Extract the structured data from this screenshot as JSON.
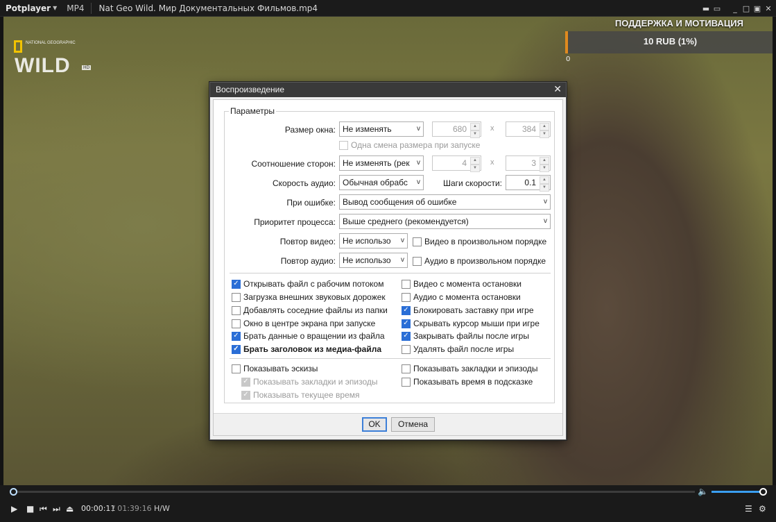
{
  "app": {
    "name": "Potplayer",
    "format": "MP4",
    "file_title": "Nat Geo Wild. Мир Документальных Фильмов.mp4"
  },
  "overlay": {
    "logo_small": "NATIONAL GEOGRAPHIC",
    "logo_big": "WILD",
    "logo_badge": "HD",
    "donate_title": "ПОДДЕРЖКА И МОТИВАЦИЯ",
    "donate_amount": "10 RUB (1%)",
    "donate_min": "0"
  },
  "dialog": {
    "title": "Воспроизведение",
    "group_label": "Параметры",
    "window_size": {
      "label": "Размер окна:",
      "value": "Не изменять",
      "width": "680",
      "height": "384"
    },
    "resize_once": {
      "label": "Одна смена размера при запуске",
      "checked": false,
      "disabled": true
    },
    "aspect": {
      "label": "Соотношение сторон:",
      "value": "Не изменять (рек",
      "w": "4",
      "h": "3"
    },
    "audio_speed": {
      "label": "Скорость аудио:",
      "value": "Обычная обрабс"
    },
    "speed_step": {
      "label": "Шаги скорости:",
      "value": "0.1"
    },
    "on_error": {
      "label": "При ошибке:",
      "value": "Вывод сообщения об ошибке"
    },
    "priority": {
      "label": "Приоритет процесса:",
      "value": "Выше среднего (рекомендуется)"
    },
    "repeat_video": {
      "label": "Повтор видео:",
      "value": "Не использо",
      "shuffle_label": "Видео в произвольном порядке"
    },
    "repeat_audio": {
      "label": "Повтор аудио:",
      "value": "Не использо",
      "shuffle_label": "Аудио в произвольном порядке"
    },
    "options_left": [
      {
        "label": "Открывать файл с рабочим потоком",
        "checked": true
      },
      {
        "label": "Загрузка внешних звуковых дорожек",
        "checked": false
      },
      {
        "label": "Добавлять соседние файлы из папки",
        "checked": false
      },
      {
        "label": "Окно в центре экрана при запуске",
        "checked": false
      },
      {
        "label": "Брать данные о вращении из файла",
        "checked": true
      },
      {
        "label": "Брать заголовок из медиа-файла",
        "checked": true,
        "bold": true
      }
    ],
    "options_right": [
      {
        "label": "Видео с момента остановки",
        "checked": false
      },
      {
        "label": "Аудио с момента остановки",
        "checked": false
      },
      {
        "label": "Блокировать заставку при игре",
        "checked": true
      },
      {
        "label": "Скрывать курсор мыши при игре",
        "checked": true
      },
      {
        "label": "Закрывать файлы после игры",
        "checked": true
      },
      {
        "label": "Удалять файл после игры",
        "checked": false
      }
    ],
    "thumbs": [
      {
        "label": "Показывать эскизы",
        "checked": false
      },
      {
        "label": "Показывать закладки и эпизоды",
        "checked": true,
        "disabled": true
      },
      {
        "label": "Показывать текущее время",
        "checked": true,
        "disabled": true
      }
    ],
    "thumbs_right": [
      {
        "label": "Показывать закладки и эпизоды",
        "checked": false
      },
      {
        "label": "Показывать время в подсказке",
        "checked": false
      }
    ],
    "ok_label": "OK",
    "cancel_label": "Отмена"
  },
  "controls": {
    "time_current": "00:00:11",
    "time_total": "/ 01:39:16",
    "decoder": "H/W",
    "seek_progress": 0.002,
    "volume": 1.0
  },
  "colors": {
    "accent": "#2a6ed6",
    "donate_accent": "#e08a1e",
    "volume_fill": "#3a9ef0"
  }
}
